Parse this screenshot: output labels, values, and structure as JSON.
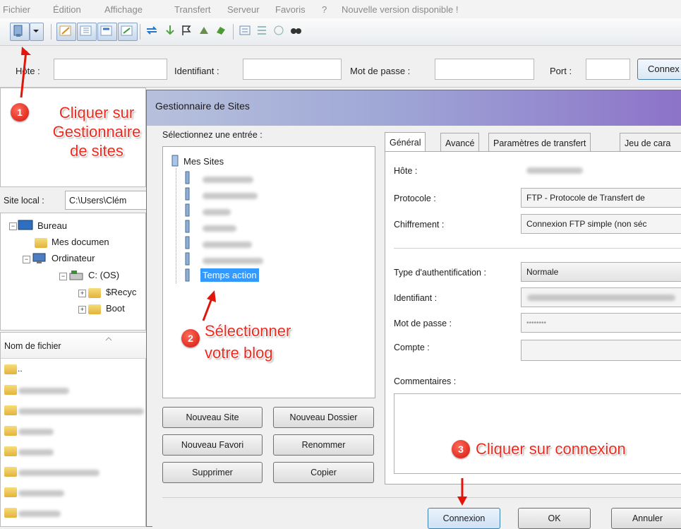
{
  "menu": [
    "Fichier",
    "Édition",
    "Affichage",
    "Transfert",
    "Serveur",
    "Favoris",
    "?",
    "Nouvelle version disponible !"
  ],
  "quickconnect": {
    "host_label": "Hôte :",
    "user_label": "Identifiant :",
    "pass_label": "Mot de passe :",
    "port_label": "Port :",
    "connect_label": "Connex"
  },
  "local": {
    "site_label": "Site local :",
    "path": "C:\\Users\\Clém",
    "tree": [
      "Bureau",
      "Mes documen",
      "Ordinateur",
      "C: (OS)",
      "$Recyc",
      "Boot"
    ],
    "file_header": "Nom de fichier",
    "parent_dir": ".."
  },
  "dialog": {
    "title": "Gestionnaire de Sites",
    "select_label": "Sélectionnez une entrée :",
    "root": "Mes Sites",
    "selected_site": "Temps action",
    "buttons": {
      "new_site": "Nouveau Site",
      "new_folder": "Nouveau Dossier",
      "new_bookmark": "Nouveau Favori",
      "rename": "Renommer",
      "delete": "Supprimer",
      "copy": "Copier",
      "connect": "Connexion",
      "ok": "OK",
      "cancel": "Annuler"
    },
    "tabs": [
      "Général",
      "Avancé",
      "Paramètres de transfert",
      "Jeu de cara"
    ],
    "fields": {
      "host_label": "Hôte :",
      "protocol_label": "Protocole :",
      "protocol_value": "FTP - Protocole de Transfert de",
      "encryption_label": "Chiffrement :",
      "encryption_value": "Connexion FTP simple (non séc",
      "auth_label": "Type d'authentification :",
      "auth_value": "Normale",
      "user_label": "Identifiant :",
      "pass_label": "Mot de passe :",
      "pass_value": "••••••••",
      "account_label": "Compte :",
      "comments_label": "Commentaires :"
    }
  },
  "annotations": {
    "step1_num": "1",
    "step1_text": "Cliquer sur\nGestionnaire\nde sites",
    "step2_num": "2",
    "step2_text": "Sélectionner\nvotre blog",
    "step3_num": "3",
    "step3_text": "Cliquer sur connexion"
  },
  "colors": {
    "annotation_red": "#ee2a1f",
    "selection_blue": "#3399ff",
    "title_gradient_end": "#8c73c8"
  }
}
